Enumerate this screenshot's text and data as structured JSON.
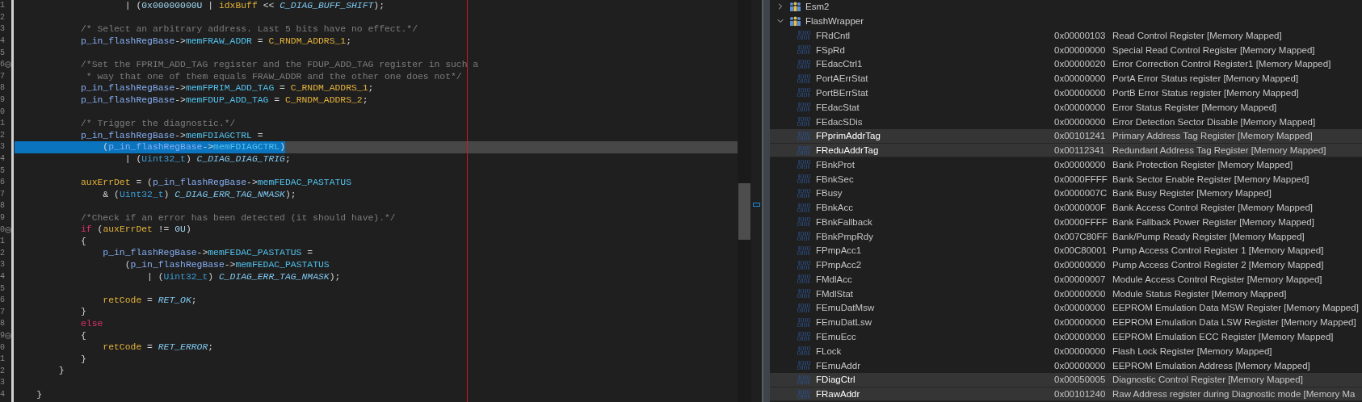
{
  "editor": {
    "lines": [
      {
        "number": "1",
        "selected": false,
        "fold": false,
        "tokens": [
          {
            "kind": "plain",
            "text": "                    | ("
          },
          {
            "kind": "number",
            "text": "0x00000000U"
          },
          {
            "kind": "plain",
            "text": " | "
          },
          {
            "kind": "local",
            "text": "idxBuff"
          },
          {
            "kind": "plain",
            "text": " << "
          },
          {
            "kind": "macro",
            "text": "C_DIAG_BUFF_SHIFT"
          },
          {
            "kind": "plain",
            "text": ");"
          }
        ]
      },
      {
        "number": "2",
        "selected": false,
        "fold": false
      },
      {
        "number": "3",
        "selected": false,
        "fold": false,
        "tokens": [
          {
            "kind": "comment",
            "text": "            /* Select an arbitrary address. Last 5 bits have no effect.*/"
          }
        ]
      },
      {
        "number": "4",
        "selected": false,
        "fold": false,
        "tokens": [
          {
            "kind": "var",
            "text": "            p_in_flashRegBase"
          },
          {
            "kind": "plain",
            "text": "->"
          },
          {
            "kind": "member",
            "text": "memFRAW_ADDR"
          },
          {
            "kind": "plain",
            "text": " = "
          },
          {
            "kind": "const",
            "text": "C_RNDM_ADDRS_1"
          },
          {
            "kind": "plain",
            "text": ";"
          }
        ]
      },
      {
        "number": "5",
        "selected": false,
        "fold": false
      },
      {
        "number": "6",
        "selected": false,
        "fold": true,
        "tokens": [
          {
            "kind": "comment",
            "text": "            /*Set the FPRIM_ADD_TAG register and the FDUP_ADD_TAG register in such a"
          }
        ]
      },
      {
        "number": "7",
        "selected": false,
        "fold": false,
        "tokens": [
          {
            "kind": "comment",
            "text": "             * way that one of them equals FRAW_ADDR and the other one does not*/"
          }
        ]
      },
      {
        "number": "8",
        "selected": false,
        "fold": false,
        "tokens": [
          {
            "kind": "var",
            "text": "            p_in_flashRegBase"
          },
          {
            "kind": "plain",
            "text": "->"
          },
          {
            "kind": "member",
            "text": "memFPRIM_ADD_TAG"
          },
          {
            "kind": "plain",
            "text": " = "
          },
          {
            "kind": "const",
            "text": "C_RNDM_ADDRS_1"
          },
          {
            "kind": "plain",
            "text": ";"
          }
        ]
      },
      {
        "number": "9",
        "selected": false,
        "fold": false,
        "tokens": [
          {
            "kind": "var",
            "text": "            p_in_flashRegBase"
          },
          {
            "kind": "plain",
            "text": "->"
          },
          {
            "kind": "member",
            "text": "memFDUP_ADD_TAG"
          },
          {
            "kind": "plain",
            "text": " = "
          },
          {
            "kind": "const",
            "text": "C_RNDM_ADDRS_2"
          },
          {
            "kind": "plain",
            "text": ";"
          }
        ]
      },
      {
        "number": "0",
        "selected": false,
        "fold": false
      },
      {
        "number": "1",
        "selected": false,
        "fold": false,
        "tokens": [
          {
            "kind": "comment",
            "text": "            /* Trigger the diagnostic.*/"
          }
        ]
      },
      {
        "number": "2",
        "selected": false,
        "fold": false,
        "tokens": [
          {
            "kind": "var",
            "text": "            p_in_flashRegBase"
          },
          {
            "kind": "plain",
            "text": "->"
          },
          {
            "kind": "member",
            "text": "memFDIAGCTRL"
          },
          {
            "kind": "plain",
            "text": " ="
          }
        ]
      },
      {
        "number": "3",
        "selected": true,
        "fold": false,
        "tokens": [
          {
            "kind": "plain",
            "text": "                ("
          },
          {
            "kind": "var",
            "text": "p_in_flashRegBase"
          },
          {
            "kind": "plain",
            "text": "->"
          },
          {
            "kind": "member",
            "text": "memFDIAGCTRL"
          },
          {
            "kind": "plain",
            "text": ")"
          }
        ]
      },
      {
        "number": "4",
        "selected": false,
        "fold": false,
        "tokens": [
          {
            "kind": "plain",
            "text": "                    | ("
          },
          {
            "kind": "type",
            "text": "Uint32_t"
          },
          {
            "kind": "plain",
            "text": ") "
          },
          {
            "kind": "macro",
            "text": "C_DIAG_DIAG_TRIG"
          },
          {
            "kind": "plain",
            "text": ";"
          }
        ]
      },
      {
        "number": "5",
        "selected": false,
        "fold": false
      },
      {
        "number": "6",
        "selected": false,
        "fold": false,
        "tokens": [
          {
            "kind": "local",
            "text": "            auxErrDet"
          },
          {
            "kind": "plain",
            "text": " = ("
          },
          {
            "kind": "var",
            "text": "p_in_flashRegBase"
          },
          {
            "kind": "plain",
            "text": "->"
          },
          {
            "kind": "member",
            "text": "memFEDAC_PASTATUS"
          }
        ]
      },
      {
        "number": "7",
        "selected": false,
        "fold": false,
        "tokens": [
          {
            "kind": "plain",
            "text": "                & ("
          },
          {
            "kind": "type",
            "text": "Uint32_t"
          },
          {
            "kind": "plain",
            "text": ") "
          },
          {
            "kind": "macro",
            "text": "C_DIAG_ERR_TAG_NMASK"
          },
          {
            "kind": "plain",
            "text": ");"
          }
        ]
      },
      {
        "number": "8",
        "selected": false,
        "fold": false
      },
      {
        "number": "9",
        "selected": false,
        "fold": false,
        "tokens": [
          {
            "kind": "comment",
            "text": "            /*Check if an error has been detected (it should have).*/"
          }
        ]
      },
      {
        "number": "0",
        "selected": false,
        "fold": true,
        "tokens": [
          {
            "kind": "keyword",
            "text": "            if"
          },
          {
            "kind": "plain",
            "text": " ("
          },
          {
            "kind": "local",
            "text": "auxErrDet"
          },
          {
            "kind": "plain",
            "text": " != "
          },
          {
            "kind": "number",
            "text": "0U"
          },
          {
            "kind": "plain",
            "text": ")"
          }
        ]
      },
      {
        "number": "1",
        "selected": false,
        "fold": false,
        "tokens": [
          {
            "kind": "plain",
            "text": "            {"
          }
        ]
      },
      {
        "number": "2",
        "selected": false,
        "fold": false,
        "tokens": [
          {
            "kind": "var",
            "text": "                p_in_flashRegBase"
          },
          {
            "kind": "plain",
            "text": "->"
          },
          {
            "kind": "member",
            "text": "memFEDAC_PASTATUS"
          },
          {
            "kind": "plain",
            "text": " ="
          }
        ]
      },
      {
        "number": "3",
        "selected": false,
        "fold": false,
        "tokens": [
          {
            "kind": "plain",
            "text": "                    ("
          },
          {
            "kind": "var",
            "text": "p_in_flashRegBase"
          },
          {
            "kind": "plain",
            "text": "->"
          },
          {
            "kind": "member",
            "text": "memFEDAC_PASTATUS"
          }
        ]
      },
      {
        "number": "4",
        "selected": false,
        "fold": false,
        "tokens": [
          {
            "kind": "plain",
            "text": "                        | ("
          },
          {
            "kind": "type",
            "text": "Uint32_t"
          },
          {
            "kind": "plain",
            "text": ") "
          },
          {
            "kind": "macro",
            "text": "C_DIAG_ERR_TAG_NMASK"
          },
          {
            "kind": "plain",
            "text": ");"
          }
        ]
      },
      {
        "number": "5",
        "selected": false,
        "fold": false
      },
      {
        "number": "6",
        "selected": false,
        "fold": false,
        "tokens": [
          {
            "kind": "local",
            "text": "                retCode"
          },
          {
            "kind": "plain",
            "text": " = "
          },
          {
            "kind": "macro",
            "text": "RET_OK"
          },
          {
            "kind": "plain",
            "text": ";"
          }
        ]
      },
      {
        "number": "7",
        "selected": false,
        "fold": false,
        "tokens": [
          {
            "kind": "plain",
            "text": "            }"
          }
        ]
      },
      {
        "number": "8",
        "selected": false,
        "fold": false,
        "tokens": [
          {
            "kind": "keyword",
            "text": "            else"
          }
        ]
      },
      {
        "number": "9",
        "selected": false,
        "fold": true,
        "tokens": [
          {
            "kind": "plain",
            "text": "            {"
          }
        ]
      },
      {
        "number": "0",
        "selected": false,
        "fold": false,
        "tokens": [
          {
            "kind": "local",
            "text": "                retCode"
          },
          {
            "kind": "plain",
            "text": " = "
          },
          {
            "kind": "macro",
            "text": "RET_ERROR"
          },
          {
            "kind": "plain",
            "text": ";"
          }
        ]
      },
      {
        "number": "1",
        "selected": false,
        "fold": false,
        "tokens": [
          {
            "kind": "plain",
            "text": "            }"
          }
        ]
      },
      {
        "number": "2",
        "selected": false,
        "fold": false,
        "tokens": [
          {
            "kind": "plain",
            "text": "        }"
          }
        ]
      },
      {
        "number": "3",
        "selected": false,
        "fold": false
      },
      {
        "number": "4",
        "selected": false,
        "fold": false,
        "tokens": [
          {
            "kind": "plain",
            "text": "    }"
          }
        ]
      }
    ]
  },
  "registers": {
    "nodes": [
      {
        "label": "Esm2",
        "expanded": false
      },
      {
        "label": "FlashWrapper",
        "expanded": true,
        "children": [
          {
            "name": "FRdCntl",
            "value": "0x00000103",
            "description": "Read Control Register [Memory Mapped]",
            "selected": false
          },
          {
            "name": "FSpRd",
            "value": "0x00000000",
            "description": "Special Read Control Register [Memory Mapped]",
            "selected": false
          },
          {
            "name": "FEdacCtrl1",
            "value": "0x00000020",
            "description": "Error Correction Control Register1 [Memory Mapped]",
            "selected": false
          },
          {
            "name": "PortAErrStat",
            "value": "0x00000000",
            "description": "PortA Error Status register [Memory Mapped]",
            "selected": false
          },
          {
            "name": "PortBErrStat",
            "value": "0x00000000",
            "description": "PortB Error Status register [Memory Mapped]",
            "selected": false
          },
          {
            "name": "FEdacStat",
            "value": "0x00000000",
            "description": "Error Status Register [Memory Mapped]",
            "selected": false
          },
          {
            "name": "FEdacSDis",
            "value": "0x00000000",
            "description": "Error Detection Sector Disable [Memory Mapped]",
            "selected": false
          },
          {
            "name": "FPprimAddrTag",
            "value": "0x00101241",
            "description": "Primary Address Tag Register [Memory Mapped]",
            "selected": true
          },
          {
            "name": "FReduAddrTag",
            "value": "0x00112341",
            "description": "Redundant Address Tag Register [Memory Mapped]",
            "selected": true
          },
          {
            "name": "FBnkProt",
            "value": "0x00000000",
            "description": "Bank Protection Register [Memory Mapped]",
            "selected": false
          },
          {
            "name": "FBnkSec",
            "value": "0x0000FFFF",
            "description": "Bank Sector Enable Register [Memory Mapped]",
            "selected": false
          },
          {
            "name": "FBusy",
            "value": "0x0000007C",
            "description": "Bank Busy Register [Memory Mapped]",
            "selected": false
          },
          {
            "name": "FBnkAcc",
            "value": "0x0000000F",
            "description": "Bank Access Control Register [Memory Mapped]",
            "selected": false
          },
          {
            "name": "FBnkFallback",
            "value": "0x0000FFFF",
            "description": "Bank Fallback Power Register [Memory Mapped]",
            "selected": false
          },
          {
            "name": "FBnkPmpRdy",
            "value": "0x007C80FF",
            "description": "Bank/Pump Ready Register [Memory Mapped]",
            "selected": false
          },
          {
            "name": "FPmpAcc1",
            "value": "0x00C80001",
            "description": "Pump Access Control Register 1 [Memory Mapped]",
            "selected": false
          },
          {
            "name": "FPmpAcc2",
            "value": "0x00000000",
            "description": "Pump Access Control Register 2 [Memory Mapped]",
            "selected": false
          },
          {
            "name": "FMdlAcc",
            "value": "0x00000007",
            "description": "Module Access Control Register [Memory Mapped]",
            "selected": false
          },
          {
            "name": "FMdlStat",
            "value": "0x00000000",
            "description": "Module Status Register [Memory Mapped]",
            "selected": false
          },
          {
            "name": "FEmuDatMsw",
            "value": "0x00000000",
            "description": "EEPROM Emulation Data MSW Register [Memory Mapped]",
            "selected": false
          },
          {
            "name": "FEmuDatLsw",
            "value": "0x00000000",
            "description": "EEPROM Emulation Data LSW Register [Memory Mapped]",
            "selected": false
          },
          {
            "name": "FEmuEcc",
            "value": "0x00000000",
            "description": "EEPROM Emulation ECC Register [Memory Mapped]",
            "selected": false
          },
          {
            "name": "FLock",
            "value": "0x00000000",
            "description": "Flash Lock Register [Memory Mapped]",
            "selected": false
          },
          {
            "name": "FEmuAddr",
            "value": "0x00000000",
            "description": "EEPROM Emulation Address [Memory Mapped]",
            "selected": false
          },
          {
            "name": "FDiagCtrl",
            "value": "0x00050005",
            "description": "Diagnostic Control Register [Memory Mapped]",
            "selected": true
          },
          {
            "name": "FRawAddr",
            "value": "0x00101240",
            "description": "Raw Address register during Diagnostic mode [Memory Ma",
            "selected": true
          }
        ]
      }
    ]
  }
}
